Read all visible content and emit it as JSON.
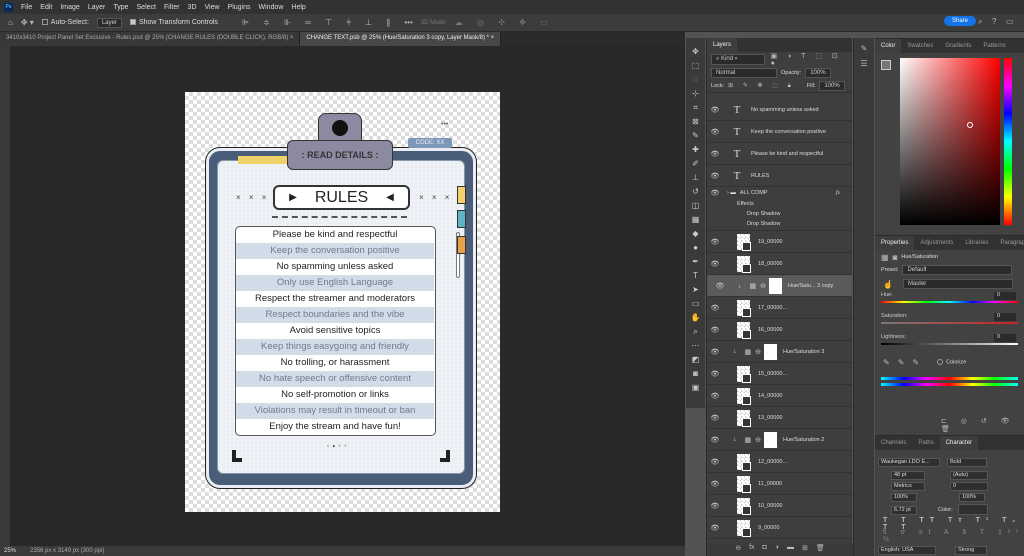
{
  "app": {
    "logo": "Ps"
  },
  "menu": [
    "File",
    "Edit",
    "Image",
    "Layer",
    "Type",
    "Select",
    "Filter",
    "3D",
    "View",
    "Plugins",
    "Window",
    "Help"
  ],
  "options": {
    "auto_select": "Auto-Select:",
    "layer_select": "Layer",
    "show_transform": "Show Transform Controls",
    "mode_3d": "3D Mode:",
    "share": "Share"
  },
  "tabs": [
    {
      "label": "3410x3410 Project Panel Set Exclusive - Rules.psd @ 25% (CHANGE RULES (DOUBLE CLICK), RGB/8)",
      "active": false
    },
    {
      "label": "CHANGE TEXT.psb @ 25% (Hue/Saturation 3 copy, Layer Mask/8) *",
      "active": true
    }
  ],
  "status": {
    "zoom": "25%",
    "doc_size": "2356 px x 3140 px (300 ppi)"
  },
  "artwork": {
    "clip_label": ": READ DETAILS :",
    "code": "CODE: XX",
    "title": "RULES",
    "deco_x": "× × ×",
    "rules": [
      "Please be kind and respectful",
      "Keep the conversation positive",
      "No spamming unless asked",
      "Only use English Language",
      "Respect the streamer and moderators",
      "Respect boundaries and the vibe",
      "Avoid sensitive topics",
      "Keep things easygoing and friendly",
      "No trolling, or harassment",
      "No hate speech or offensive content",
      "No self-promotion or links",
      "Violations may result in timeout or ban",
      "Enjoy the stream and have fun!"
    ],
    "tab_colors": [
      "#f2d16b",
      "#5fb3c4",
      "#e9a04a"
    ]
  },
  "layers": {
    "title": "Layers",
    "filter": "Kind",
    "blend": "Normal",
    "opacity_label": "Opacity:",
    "opacity": "100%",
    "lock_label": "Lock:",
    "fill_label": "Fill:",
    "fill": "100%",
    "text_layers": [
      "No spamming unless asked",
      "Keep the conversation positive",
      "Please be kind and respectful",
      "RULES"
    ],
    "group": {
      "name": "ALL COMP",
      "fx": "fx",
      "effects": "Effects",
      "drop1": "Drop Shadow",
      "drop2": "Drop Shadow"
    },
    "items": [
      {
        "type": "pixel",
        "name": "19_00000"
      },
      {
        "type": "pixel",
        "name": "18_00000"
      },
      {
        "type": "adj",
        "name": "Hue/Satu... 3 copy",
        "selected": true
      },
      {
        "type": "pixel",
        "name": "17_00000..."
      },
      {
        "type": "pixel",
        "name": "16_00000"
      },
      {
        "type": "adj",
        "name": "Hue/Saturation 3"
      },
      {
        "type": "pixel",
        "name": "15_00000..."
      },
      {
        "type": "pixel",
        "name": "14_00000"
      },
      {
        "type": "pixel",
        "name": "13_00000"
      },
      {
        "type": "adj",
        "name": "Hue/Saturation 2"
      },
      {
        "type": "pixel",
        "name": "12_00000..."
      },
      {
        "type": "pixel",
        "name": "11_00000"
      },
      {
        "type": "pixel",
        "name": "10_00000"
      },
      {
        "type": "pixel",
        "name": "9_00000"
      }
    ]
  },
  "color_panel": {
    "tabs": [
      "Color",
      "Swatches",
      "Gradients",
      "Patterns"
    ]
  },
  "properties": {
    "tabs": [
      "Properties",
      "Adjustments",
      "Libraries",
      "Paragraph"
    ],
    "type": "Hue/Saturation",
    "preset_label": "Preset:",
    "preset": "Default",
    "channel": "Master",
    "hue_label": "Hue:",
    "hue": "0",
    "sat_label": "Saturation:",
    "sat": "0",
    "light_label": "Lightness:",
    "light": "0",
    "colorize": "Colorize"
  },
  "character": {
    "tabs": [
      "Channels",
      "Paths",
      "Character"
    ],
    "font": "Waukegan LDO E...",
    "style": "Bold",
    "size": "48 pt",
    "leading": "(Auto)",
    "kerning": "Metrics",
    "tracking": "0",
    "vscale": "100%",
    "hscale": "100%",
    "baseline": "6.72 pt",
    "color_label": "Color:",
    "language": "English: USA",
    "aa": "Strong"
  }
}
